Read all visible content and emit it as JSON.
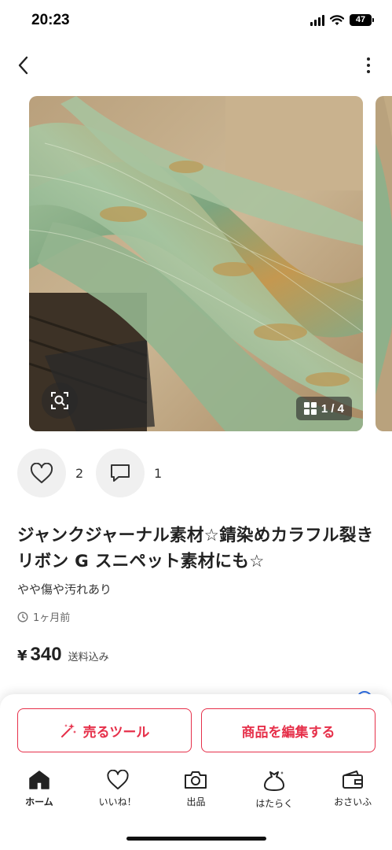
{
  "status_bar": {
    "time": "20:23",
    "battery": "47"
  },
  "gallery": {
    "counter": "1 / 4"
  },
  "actions": {
    "likes_count": "2",
    "comments_count": "1"
  },
  "item": {
    "title": "ジャンクジャーナル素材☆錆染めカラフル裂きリボン G スニペット素材にも☆",
    "condition": "やや傷や汚れあり",
    "posted": "1ヶ月前",
    "currency": "¥",
    "price": "340",
    "shipping": "送料込み"
  },
  "cta": {
    "sell_tool": "売るツール",
    "edit_item": "商品を編集する"
  },
  "tabs": [
    {
      "label": "ホーム",
      "icon": "home-icon",
      "active": true
    },
    {
      "label": "いいね！",
      "icon": "heart-icon",
      "active": false
    },
    {
      "label": "出品",
      "icon": "camera-icon",
      "active": false
    },
    {
      "label": "はたらく",
      "icon": "money-bag-icon",
      "active": false
    },
    {
      "label": "おさいふ",
      "icon": "wallet-icon",
      "active": false
    }
  ],
  "colors": {
    "accent": "#e6304a",
    "info": "#2f6fe4",
    "circle_bg": "#f0f0f0"
  }
}
